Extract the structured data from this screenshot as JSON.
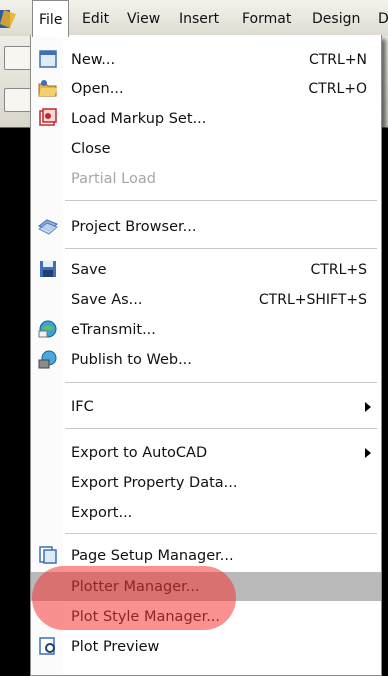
{
  "menubar": {
    "items": [
      {
        "label": "File",
        "active": true
      },
      {
        "label": "Edit"
      },
      {
        "label": "View"
      },
      {
        "label": "Insert"
      },
      {
        "label": "Format"
      },
      {
        "label": "Design"
      },
      {
        "label": "D"
      }
    ]
  },
  "file_menu": {
    "items": [
      {
        "label": "New...",
        "shortcut": "CTRL+N",
        "icon": "new-document-icon"
      },
      {
        "label": "Open...",
        "shortcut": "CTRL+O",
        "icon": "open-folder-icon"
      },
      {
        "label": "Load Markup Set...",
        "icon": "markup-set-icon"
      },
      {
        "label": "Close"
      },
      {
        "label": "Partial Load",
        "disabled": true
      },
      {
        "label": "Project Browser...",
        "icon": "project-browser-icon"
      },
      {
        "label": "Save",
        "shortcut": "CTRL+S",
        "icon": "save-icon"
      },
      {
        "label": "Save As...",
        "shortcut": "CTRL+SHIFT+S"
      },
      {
        "label": "eTransmit...",
        "icon": "etransmit-icon"
      },
      {
        "label": "Publish to Web...",
        "icon": "publish-web-icon"
      },
      {
        "label": "IFC",
        "submenu": true
      },
      {
        "label": "Export to AutoCAD",
        "submenu": true
      },
      {
        "label": "Export Property Data..."
      },
      {
        "label": "Export..."
      },
      {
        "label": "Page Setup Manager...",
        "icon": "page-setup-icon"
      },
      {
        "label": "Plotter Manager...",
        "highlighted": true
      },
      {
        "label": "Plot Style Manager..."
      },
      {
        "label": "Plot Preview",
        "icon": "plot-preview-icon"
      }
    ]
  },
  "colors": {
    "highlight": "#b9b9b9",
    "annotation": "#f53737",
    "disabled_text": "#a6a6a6"
  }
}
